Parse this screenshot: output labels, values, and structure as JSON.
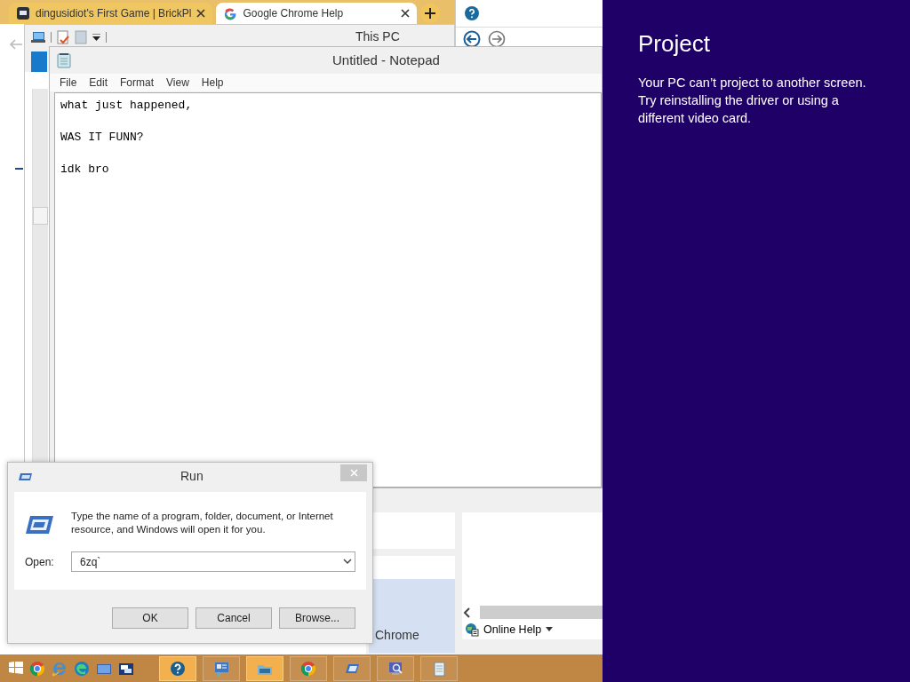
{
  "browser": {
    "tabs": [
      {
        "title": "dingusidiot's First Game | BrickPl",
        "selected": false
      },
      {
        "title": "Google Chrome Help",
        "selected": true
      }
    ]
  },
  "explorer": {
    "title": "This PC"
  },
  "notepad": {
    "title": "Untitled - Notepad",
    "menu": [
      "File",
      "Edit",
      "Format",
      "View",
      "Help"
    ],
    "lines": [
      "what just happened,",
      "WAS IT FUNN?",
      "idk bro"
    ]
  },
  "help_window": {
    "sidebar_text": "Chrome",
    "footer_link": "Online Help"
  },
  "run_dialog": {
    "title": "Run",
    "description": "Type the name of a program, folder, document, or Internet resource, and Windows will open it for you.",
    "open_label": "Open:",
    "open_value": "6zq`",
    "buttons": [
      "OK",
      "Cancel",
      "Browse..."
    ]
  },
  "project_panel": {
    "title": "Project",
    "message": "Your PC can’t project to another screen. Try reinstalling the driver or using a different video card."
  },
  "taskbar": {
    "windows": [
      {
        "kind": "help",
        "selected": true
      },
      {
        "kind": "control",
        "selected": false
      },
      {
        "kind": "folder",
        "selected": true
      },
      {
        "kind": "chrome",
        "selected": false
      },
      {
        "kind": "run",
        "selected": false
      },
      {
        "kind": "screen",
        "selected": false
      },
      {
        "kind": "notepad",
        "selected": false
      }
    ]
  }
}
